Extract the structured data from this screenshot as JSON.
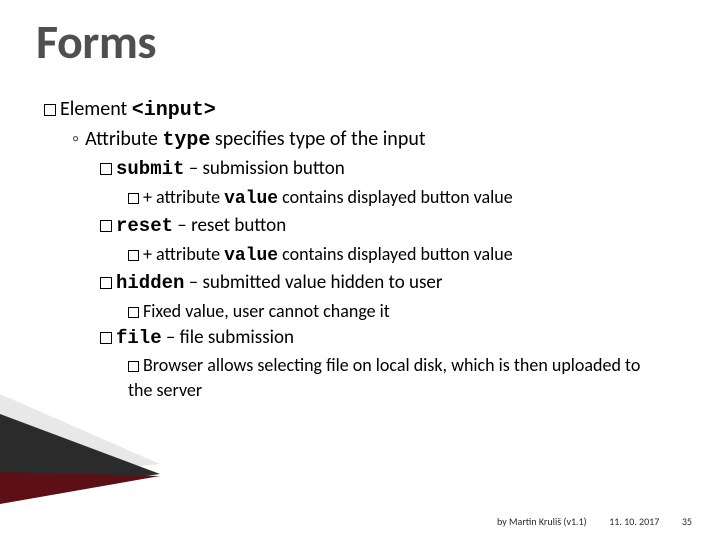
{
  "title": "Forms",
  "lvl1": {
    "prefix": "Element ",
    "code": "<input>"
  },
  "lvl2": {
    "prefix": "Attribute ",
    "code": "type",
    "suffix": " specifies type of the input"
  },
  "items": [
    {
      "code": "submit",
      "desc": " – submission button",
      "subs": [
        {
          "prefix": "+ attribute ",
          "code": "value",
          "suffix": " contains displayed button value"
        }
      ]
    },
    {
      "code": "reset",
      "desc": " – reset button",
      "subs": [
        {
          "prefix": "+ attribute ",
          "code": "value",
          "suffix": " contains displayed button value"
        }
      ]
    },
    {
      "code": "hidden",
      "desc": " – submitted value hidden to user",
      "subs": [
        {
          "prefix": "",
          "code": "",
          "suffix": "Fixed value, user cannot change it"
        }
      ]
    },
    {
      "code": "file",
      "desc": " – file submission",
      "subs": [
        {
          "prefix": "",
          "code": "",
          "suffix": "Browser allows selecting file on local disk, which is then uploaded to the server"
        }
      ]
    }
  ],
  "footer": {
    "author": "by Martin Kruliš (v1.1)",
    "date": "11. 10. 2017",
    "page": "35"
  }
}
